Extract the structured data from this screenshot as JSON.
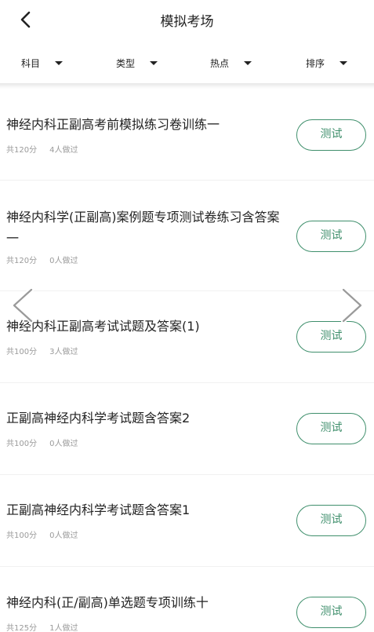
{
  "header": {
    "title": "模拟考场"
  },
  "filters": [
    {
      "label": "科目"
    },
    {
      "label": "类型"
    },
    {
      "label": "热点"
    },
    {
      "label": "排序"
    }
  ],
  "items": [
    {
      "title": "神经内科正副高考前模拟练习卷训练一",
      "score": "共120分",
      "count": "4人做过",
      "button": "测试"
    },
    {
      "title": "神经内科学(正副高)案例题专项测试卷练习含答案一",
      "score": "共120分",
      "count": "0人做过",
      "button": "测试"
    },
    {
      "title": "神经内科正副高考试试题及答案(1)",
      "score": "共100分",
      "count": "3人做过",
      "button": "测试"
    },
    {
      "title": "正副高神经内科学考试题含答案2",
      "score": "共100分",
      "count": "0人做过",
      "button": "测试"
    },
    {
      "title": "正副高神经内科学考试题含答案1",
      "score": "共100分",
      "count": "0人做过",
      "button": "测试"
    },
    {
      "title": "神经内科(正/副高)单选题专项训练十",
      "score": "共125分",
      "count": "1人做过",
      "button": "测试"
    }
  ],
  "colors": {
    "accent": "#3f8f6c",
    "meta": "#9a9a9a",
    "text": "#222222"
  },
  "icons": {
    "back": "chevron-left-icon",
    "filter": "caret-down-icon",
    "carousel_prev": "chevron-left-icon",
    "carousel_next": "chevron-right-icon"
  }
}
